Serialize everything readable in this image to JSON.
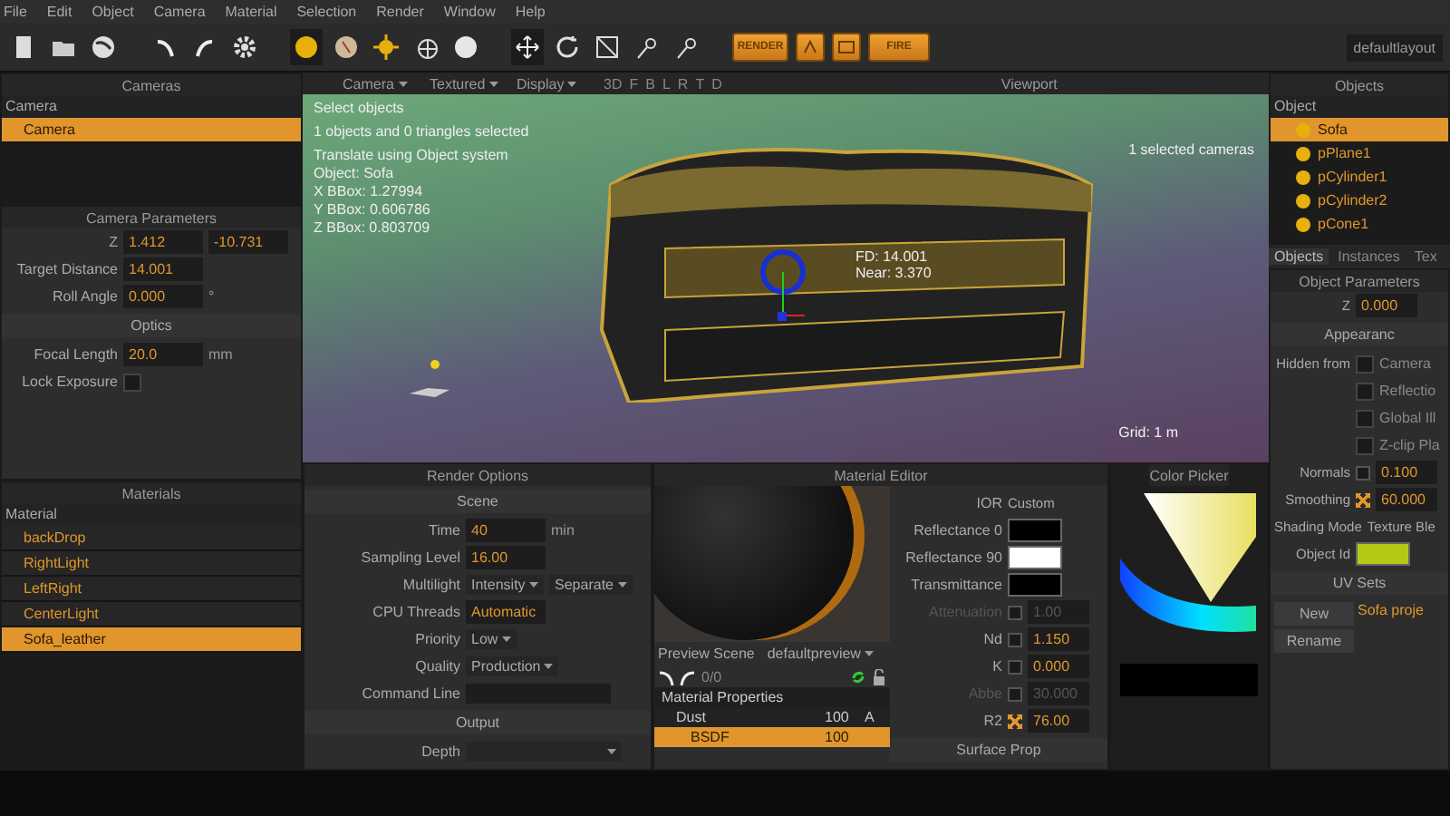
{
  "menu": [
    "File",
    "Edit",
    "Object",
    "Camera",
    "Material",
    "Selection",
    "Render",
    "Window",
    "Help"
  ],
  "toolbar": {
    "tools": [
      {
        "selected": false
      },
      {
        "selected": false
      },
      {
        "selected": false
      },
      {
        "selected": false
      },
      {
        "selected": false
      },
      {
        "selected": false
      },
      {
        "selected": true
      },
      {
        "selected": false
      },
      {
        "selected": false
      },
      {
        "selected": false
      },
      {
        "selected": false
      },
      {
        "selected": true
      },
      {
        "selected": false
      },
      {
        "selected": false
      },
      {
        "selected": false
      },
      {
        "selected": false
      }
    ],
    "render_button": "RENDER",
    "fire_button": "FIRE",
    "layout": "defaultlayout"
  },
  "cameras": {
    "title": "Cameras",
    "header": "Camera",
    "items": [
      {
        "label": "Camera",
        "selected": true
      }
    ]
  },
  "camera_parameters": {
    "title": "Camera Parameters",
    "rows": [
      {
        "kind": "pair",
        "label": "Z",
        "values": [
          "1.412",
          "-10.731"
        ]
      },
      {
        "kind": "number",
        "label": "Target Distance",
        "value": "14.001"
      },
      {
        "kind": "number",
        "label": "Roll Angle",
        "value": "0.000",
        "unit": "°"
      },
      {
        "kind": "section",
        "label": "Optics"
      },
      {
        "kind": "number",
        "label": "Focal Length",
        "value": "20.0",
        "unit": "mm"
      },
      {
        "kind": "checkbox",
        "label": "Lock Exposure",
        "checked": false
      }
    ]
  },
  "materials": {
    "title": "Materials",
    "header": "Material",
    "items": [
      {
        "label": "backDrop",
        "selected": false
      },
      {
        "label": "RightLight",
        "selected": false
      },
      {
        "label": "LeftRight",
        "selected": false
      },
      {
        "label": "CenterLight",
        "selected": false
      },
      {
        "label": "Sofa_leather",
        "selected": true
      }
    ]
  },
  "viewport": {
    "title": "Viewport",
    "menus": [
      "Camera",
      "Textured",
      "Display"
    ],
    "views": [
      "3D",
      "F",
      "B",
      "L",
      "R",
      "T",
      "D"
    ],
    "info": [
      "Select objects",
      "1 objects and 0 triangles selected",
      "Translate using Object system",
      "Object: Sofa",
      "X BBox: 1.27994",
      "Y BBox: 0.606786",
      "Z BBox: 0.803709"
    ],
    "camera_info": [
      "FD: 14.001",
      "Near: 3.370"
    ],
    "selection_note": "1 selected cameras",
    "grid": "Grid: 1 m"
  },
  "render_options": {
    "title": "Render Options",
    "rows": [
      {
        "kind": "section",
        "label": "Scene"
      },
      {
        "kind": "number",
        "label": "Time",
        "value": "40",
        "unit": "min"
      },
      {
        "kind": "number",
        "label": "Sampling Level",
        "value": "16.00"
      },
      {
        "kind": "dropdown",
        "label": "Multilight",
        "values": [
          "Intensity",
          "Separate"
        ]
      },
      {
        "kind": "number",
        "label": "CPU Threads",
        "value": "Automatic"
      },
      {
        "kind": "dropdown",
        "label": "Priority",
        "values": [
          "Low"
        ]
      },
      {
        "kind": "dropdown",
        "label": "Quality",
        "values": [
          "Production"
        ]
      },
      {
        "kind": "field",
        "label": "Command Line"
      },
      {
        "kind": "section",
        "label": "Output"
      },
      {
        "kind": "dropdown",
        "label": "Depth",
        "values": []
      }
    ]
  },
  "material_editor": {
    "title": "Material Editor",
    "preview_label": "Preview Scene",
    "preview_scene": "defaultpreview",
    "counter": "0/0",
    "tree_title": "Material Properties",
    "tree": [
      {
        "label": "Dust",
        "value": "100",
        "flag": "A",
        "selected": false,
        "children": [
          {
            "label": "BSDF",
            "value": "100",
            "selected": true
          }
        ]
      }
    ],
    "rows": [
      {
        "kind": "text",
        "label": "IOR",
        "value": "Custom"
      },
      {
        "kind": "swatch",
        "label": "Reflectance 0",
        "color": "#000000"
      },
      {
        "kind": "swatch",
        "label": "Reflectance 90",
        "color": "#ffffff"
      },
      {
        "kind": "swatch",
        "label": "Transmittance",
        "color": "#000000"
      },
      {
        "kind": "number",
        "label": "Attenuation",
        "value": "1.00",
        "disabled": true,
        "keyed": false
      },
      {
        "kind": "number",
        "label": "Nd",
        "value": "1.150",
        "disabled": false,
        "keyed": false
      },
      {
        "kind": "number",
        "label": "K",
        "value": "0.000",
        "disabled": false,
        "keyed": false
      },
      {
        "kind": "number",
        "label": "Abbe",
        "value": "30.000",
        "disabled": true,
        "keyed": false
      },
      {
        "kind": "number",
        "label": "R2",
        "value": "76.00",
        "disabled": false,
        "keyed": true
      },
      {
        "kind": "section",
        "label": "Surface Prop"
      }
    ]
  },
  "color_picker": {
    "title": "Color Picker"
  },
  "objects": {
    "title": "Objects",
    "header": "Object",
    "items": [
      {
        "label": "Sofa",
        "selected": true
      },
      {
        "label": "pPlane1",
        "selected": false
      },
      {
        "label": "pCylinder1",
        "selected": false
      },
      {
        "label": "pCylinder2",
        "selected": false
      },
      {
        "label": "pCone1",
        "selected": false
      }
    ],
    "tabs": [
      {
        "label": "Objects",
        "selected": true
      },
      {
        "label": "Instances",
        "selected": false
      },
      {
        "label": "Tex",
        "selected": false
      }
    ]
  },
  "object_parameters": {
    "title": "Object Parameters",
    "rows": [
      {
        "kind": "number",
        "label": "Z",
        "value": "0.000"
      },
      {
        "kind": "section",
        "label": "Appearanc"
      },
      {
        "kind": "checkbox",
        "label": "Hidden from",
        "text": "Camera",
        "checked": false
      },
      {
        "kind": "checkbox",
        "text": "Reflectio",
        "checked": false
      },
      {
        "kind": "checkbox",
        "text": "Global Ill",
        "checked": false
      },
      {
        "kind": "checkbox",
        "text": "Z-clip Pla",
        "checked": false
      },
      {
        "kind": "checknumber",
        "label": "Normals",
        "value": "0.100",
        "checked": false
      },
      {
        "kind": "checknumber",
        "label": "Smoothing",
        "value": "60.000",
        "checked": true
      },
      {
        "kind": "text",
        "label": "Shading Mode",
        "value": "Texture Ble"
      },
      {
        "kind": "swatch",
        "label": "Object Id",
        "color": "#b4c814"
      },
      {
        "kind": "section",
        "label": "UV Sets"
      },
      {
        "kind": "uv",
        "buttons": [
          "New",
          "Rename"
        ],
        "item": "Sofa proje"
      }
    ]
  }
}
